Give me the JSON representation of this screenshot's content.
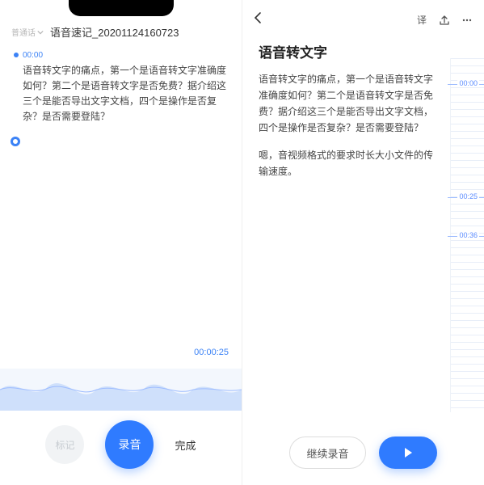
{
  "left": {
    "language": "普通话",
    "title": "语音速记_20201124160723",
    "segment_time": "00:00",
    "segment_text": "语音转文字的痛点，第一个是语音转文字准确度如何？第二个是语音转文字是否免费？据介绍这三个是能否导出文字文档，四个是操作是否复杂？是否需要登陆？",
    "elapsed": "00:00:25",
    "btn_mark": "标记",
    "btn_record": "录音",
    "btn_done": "完成"
  },
  "right": {
    "title": "语音转文字",
    "para1": "语音转文字的痛点，第一个是语音转文字准确度如何？第二个是语音转文字是否免费？据介绍这三个是能否导出文字文档，四个是操作是否复杂？是否需要登陆？",
    "para2": "嗯，音视频格式的要求时长大小文件的传输速度。",
    "translate_label": "译",
    "marks": [
      "00:00",
      "00:25",
      "00:36"
    ],
    "btn_continue": "继续录音"
  }
}
